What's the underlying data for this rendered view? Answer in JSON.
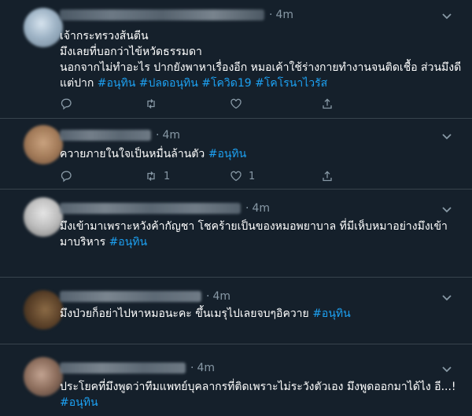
{
  "colors": {
    "background": "#15202b",
    "text": "#ffffff",
    "muted": "#8899a6",
    "hashtag": "#1da1f2",
    "divider": "#38444d"
  },
  "icons": {
    "reply": "reply-icon",
    "retweet": "retweet-icon",
    "like": "like-icon",
    "share": "share-icon",
    "more": "chevron-down-icon"
  },
  "tweets": [
    {
      "time": "4m",
      "lines": [
        {
          "text": "เจ้ากระทรวงส้นตีน",
          "tags": ""
        },
        {
          "text": "มึงเลยที่บอกว่าไข้หวัดธรรมดา",
          "tags": ""
        },
        {
          "text": "นอกจากไม่ทำอะไร ปากยังพาหาเรื่องอีก หมอเค้าใช้ร่างกายทำงานจนติดเชื้อ ส่วนมึงดี",
          "tags": ""
        },
        {
          "text": "แต่ปาก ",
          "tags": "#อนุทิน #ปลดอนุทิน #โควิด19 #โคโรนาไวรัส"
        }
      ],
      "reply_count": "",
      "retweet_count": "",
      "like_count": ""
    },
    {
      "time": "4m",
      "lines": [
        {
          "text": "ควายภายในใจเป็นหมื่นล้านตัว ",
          "tags": "#อนุทิน"
        }
      ],
      "reply_count": "",
      "retweet_count": "1",
      "like_count": "1"
    },
    {
      "time": "4m",
      "lines": [
        {
          "text": "มึงเข้ามาเพราะหวังค้ากัญชา โชคร้ายเป็นของหมอพยาบาล ที่มีเห็บหมาอย่างมึงเข้า",
          "tags": ""
        },
        {
          "text": "มาบริหาร ",
          "tags": "#อนุทิน"
        }
      ],
      "reply_count": "",
      "retweet_count": "",
      "like_count": ""
    },
    {
      "time": "4m",
      "lines": [
        {
          "text": "มึงป่วยก็อย่าไปหาหมอนะคะ ขึ้นเมรุไปเลยจบๆอิควาย ",
          "tags": "#อนุทิน"
        }
      ],
      "reply_count": "",
      "retweet_count": "",
      "like_count": ""
    },
    {
      "time": "4m",
      "lines": [
        {
          "text": "ประโยคที่มึงพูดว่าทีมแพทย์บุคลากรที่ติดเพราะไม่ระวังตัวเอง มึงพูดออกมาได้ไง อี...!",
          "tags": ""
        },
        {
          "text": "",
          "tags": "#อนุทิน"
        }
      ],
      "reply_count": "",
      "retweet_count": "",
      "like_count": ""
    }
  ]
}
